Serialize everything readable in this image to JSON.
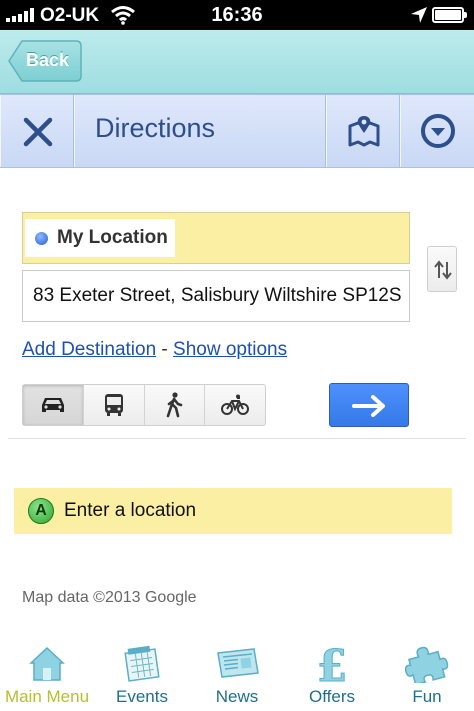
{
  "status_bar": {
    "carrier": "O2-UK",
    "time": "16:36",
    "signal_bars": 5,
    "battery_level": 1.0
  },
  "nav": {
    "back_label": "Back"
  },
  "header": {
    "title": "Directions",
    "icons": [
      "close-icon",
      "map-icon",
      "chevron-down-icon"
    ]
  },
  "directions": {
    "from_value": "My Location",
    "to_value": "83 Exeter Street, Salisbury Wiltshire SP12S",
    "add_destination_link": "Add Destination",
    "separator": " - ",
    "show_options_link": "Show options",
    "travel_modes": [
      {
        "name": "car",
        "icon": "car-icon",
        "selected": true
      },
      {
        "name": "transit",
        "icon": "bus-icon",
        "selected": false
      },
      {
        "name": "walking",
        "icon": "walking-icon",
        "selected": false
      },
      {
        "name": "bicycling",
        "icon": "bicycle-icon",
        "selected": false
      }
    ],
    "go_icon": "arrow-right-icon"
  },
  "result": {
    "marker": "A",
    "text": "Enter a location"
  },
  "attribution": "Map data ©2013 Google",
  "tabs": [
    {
      "label": "Main Menu",
      "icon": "house-icon",
      "active": true
    },
    {
      "label": "Events",
      "icon": "calendar-icon",
      "active": false
    },
    {
      "label": "News",
      "icon": "newspaper-icon",
      "active": false
    },
    {
      "label": "Offers",
      "icon": "pound-icon",
      "active": false
    },
    {
      "label": "Fun",
      "icon": "puzzle-icon",
      "active": false
    }
  ],
  "colors": {
    "header_blue": "#2d4f8c",
    "link_blue": "#1f4fb5",
    "highlight_yellow": "#fbefa4",
    "go_button": "#4d90fe",
    "tab_teal": "#1f6f8b",
    "tab_active": "#b5c02a"
  }
}
